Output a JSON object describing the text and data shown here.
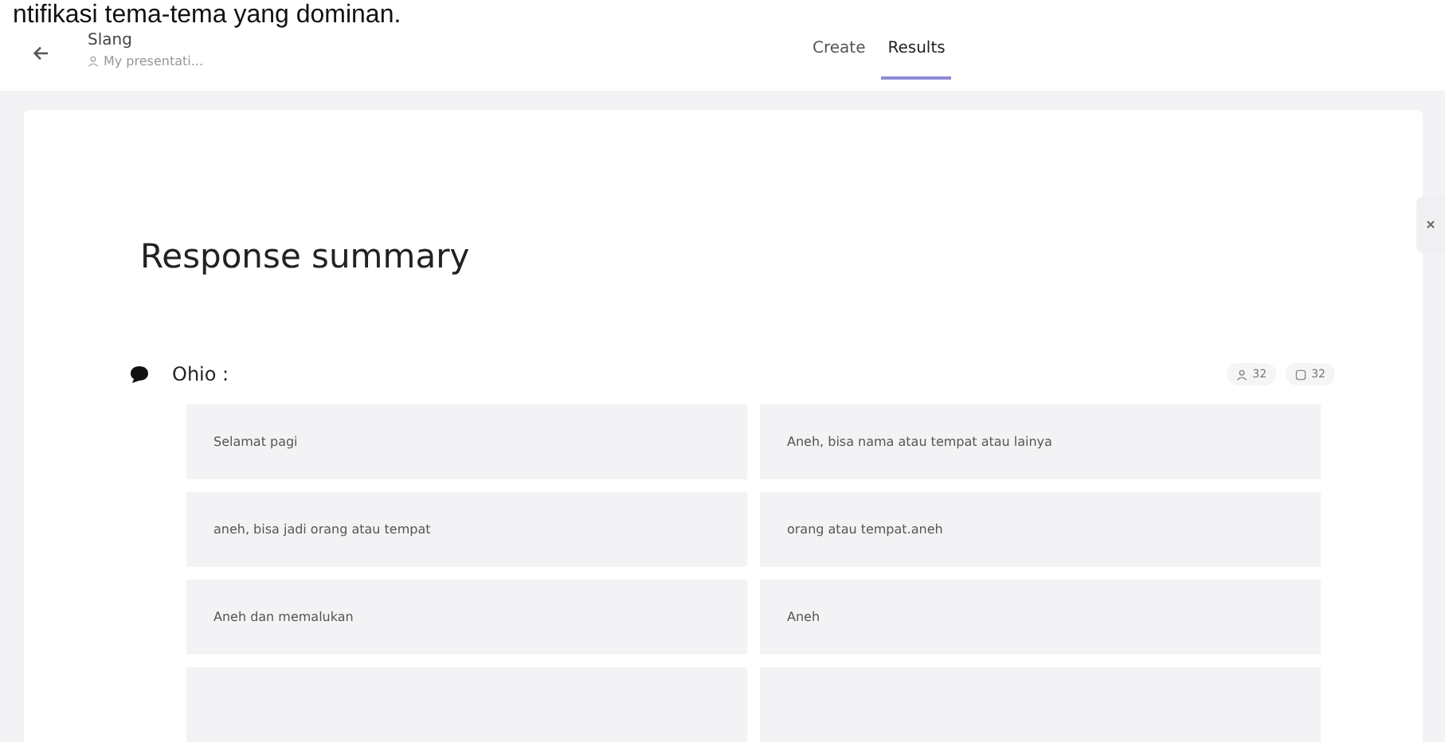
{
  "caption": "ntifikasi tema-tema yang dominan.",
  "header": {
    "title": "Slang",
    "subtitle": "My presentati..."
  },
  "tabs": [
    {
      "label": "Create",
      "selected": false
    },
    {
      "label": "Results",
      "selected": true
    }
  ],
  "summary": {
    "title": "Response summary",
    "question": {
      "label": "Ohio :",
      "respondents": "32",
      "responses": "32"
    },
    "answers": [
      "Selamat pagi",
      "Aneh, bisa nama atau tempat atau lainya",
      "aneh, bisa jadi orang atau tempat",
      "orang atau tempat.aneh",
      "Aneh dan memalukan",
      "Aneh"
    ]
  }
}
